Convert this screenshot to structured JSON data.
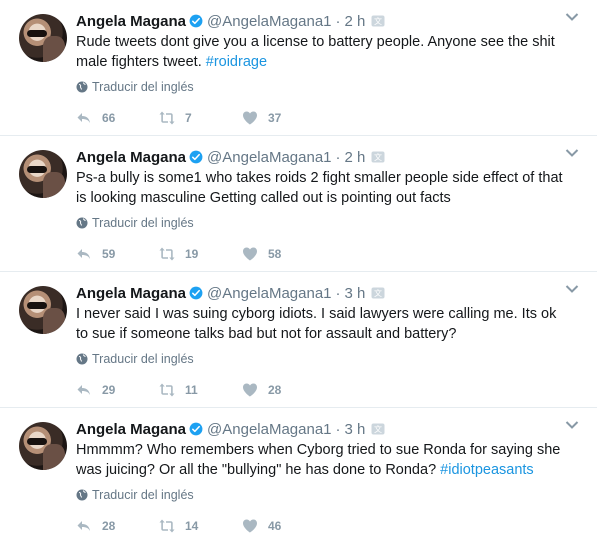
{
  "colors": {
    "link": "#1b95e0",
    "muted": "#657786",
    "border": "#e6ecf0",
    "verified": "#1da1f2"
  },
  "tweets": [
    {
      "name": "Angela Magana",
      "handle": "@AngelaMagana1",
      "dot": "·",
      "time": "2 h",
      "text": "Rude tweets dont give you a license to battery people. Anyone see the shit male fighters tweet. ",
      "hashtag": "#roidrage",
      "translate": "Traducir del inglés",
      "replies": "66",
      "retweets": "7",
      "likes": "37"
    },
    {
      "name": "Angela Magana",
      "handle": "@AngelaMagana1",
      "dot": "·",
      "time": "2 h",
      "text": "Ps-a bully is some1 who takes roids 2 fight smaller people side effect of that is looking masculine Getting called out is pointing out facts",
      "hashtag": "",
      "translate": "Traducir del inglés",
      "replies": "59",
      "retweets": "19",
      "likes": "58"
    },
    {
      "name": "Angela Magana",
      "handle": "@AngelaMagana1",
      "dot": "·",
      "time": "3 h",
      "text": "I never said I was suing cyborg idiots. I said lawyers were calling me. Its ok to sue if someone talks bad but not for assault and battery?",
      "hashtag": "",
      "translate": "Traducir del inglés",
      "replies": "29",
      "retweets": "11",
      "likes": "28"
    },
    {
      "name": "Angela Magana",
      "handle": "@AngelaMagana1",
      "dot": "·",
      "time": "3 h",
      "text": "Hmmmm? Who remembers when Cyborg tried to sue Ronda for saying she was juicing? Or all the \"bullying\" he has done to Ronda? ",
      "hashtag": "#idiotpeasants",
      "translate": "Traducir del inglés",
      "replies": "28",
      "retweets": "14",
      "likes": "46"
    }
  ]
}
